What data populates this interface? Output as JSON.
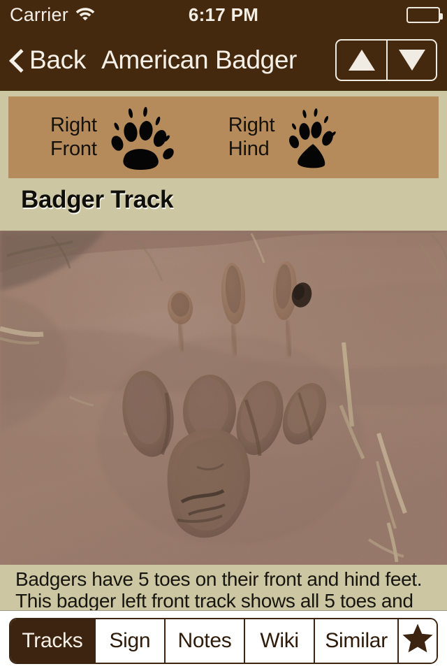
{
  "status_bar": {
    "carrier": "Carrier",
    "wifi_icon": "wifi-icon",
    "time": "6:17 PM",
    "battery_icon": "battery-icon",
    "battery_level_percent": 95
  },
  "nav_bar": {
    "back_icon": "chevron-left-icon",
    "back_label": "Back",
    "title": "American Badger",
    "prev_icon": "triangle-up-icon",
    "next_icon": "triangle-down-icon"
  },
  "paw_banner": {
    "background_color": "#B58B5C",
    "entries": [
      {
        "label_line1": "Right",
        "label_line2": "Front",
        "icon": "paw-print-front-icon"
      },
      {
        "label_line1": "Right",
        "label_line2": "Hind",
        "icon": "paw-print-hind-icon"
      }
    ]
  },
  "section": {
    "title": "Badger Track",
    "background_color": "#CCC7A2"
  },
  "photo": {
    "alt": "badger-track-in-mud-photo"
  },
  "caption": {
    "line1": "Badgers have 5 toes on their front and hind feet.",
    "line2": "This badger left front track shows all 5 toes and"
  },
  "tab_bar": {
    "accent_color": "#3D2410",
    "selected": "Tracks",
    "tabs": [
      {
        "label": "Tracks",
        "selected": true,
        "icon": null
      },
      {
        "label": "Sign",
        "selected": false,
        "icon": null
      },
      {
        "label": "Notes",
        "selected": false,
        "icon": null
      },
      {
        "label": "Wiki",
        "selected": false,
        "icon": null
      },
      {
        "label": "Similar",
        "selected": false,
        "icon": null
      },
      {
        "label": "",
        "selected": false,
        "icon": "star-icon"
      }
    ]
  }
}
